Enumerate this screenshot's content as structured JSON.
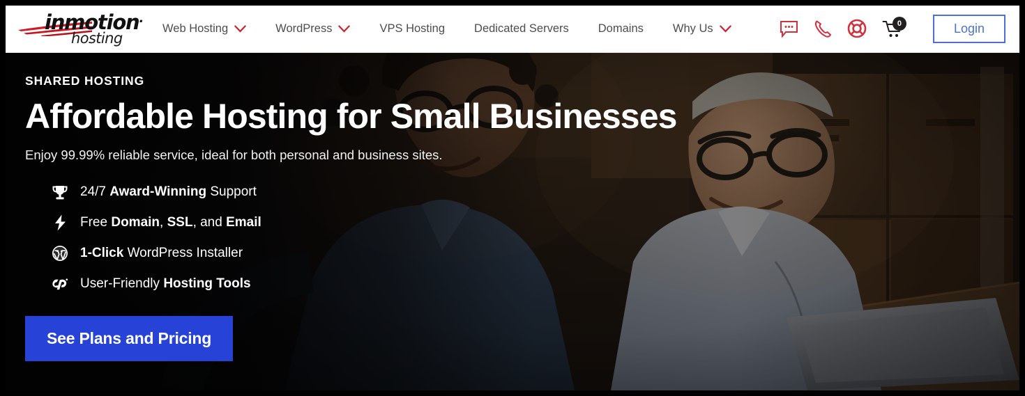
{
  "brand": {
    "logo_word": "inmotion",
    "logo_sub": "hosting",
    "accent_red": "#cf2030",
    "accent_blue": "#2742d6",
    "login_blue": "#4a6fdc"
  },
  "header": {
    "nav": [
      {
        "label": "Web Hosting",
        "has_dropdown": true,
        "icon": "chevron-down-icon"
      },
      {
        "label": "WordPress",
        "has_dropdown": true,
        "icon": "chevron-down-icon"
      },
      {
        "label": "VPS Hosting",
        "has_dropdown": false,
        "icon": ""
      },
      {
        "label": "Dedicated Servers",
        "has_dropdown": false,
        "icon": ""
      },
      {
        "label": "Domains",
        "has_dropdown": false,
        "icon": ""
      },
      {
        "label": "Why Us",
        "has_dropdown": true,
        "icon": "chevron-down-icon"
      }
    ],
    "icons": [
      {
        "name": "chat-icon",
        "title": "Live Chat"
      },
      {
        "name": "phone-icon",
        "title": "Call Us"
      },
      {
        "name": "lifering-support-icon",
        "title": "Support"
      }
    ],
    "cart": {
      "name": "shopping-cart-icon",
      "count": "0"
    },
    "login_label": "Login"
  },
  "hero": {
    "eyebrow": "SHARED HOSTING",
    "headline": "Affordable Hosting for Small Businesses",
    "subhead": "Enjoy 99.99% reliable service, ideal for both personal and business sites.",
    "features": [
      {
        "icon": "trophy-icon",
        "pre": "24/7 ",
        "strong": "Award-Winning",
        "post": " Support"
      },
      {
        "icon": "lightning-icon",
        "pre": "Free ",
        "strong": "Domain",
        "post": ", ",
        "strong2": "SSL",
        "post2": ", and ",
        "strong3": "Email"
      },
      {
        "icon": "wordpress-icon",
        "pre": "",
        "strong": "1-Click",
        "post": " WordPress Installer"
      },
      {
        "icon": "cpanel-icon",
        "pre": "User-Friendly ",
        "strong": "Hosting Tools",
        "post": ""
      }
    ],
    "cta_label": "See Plans and Pricing"
  }
}
